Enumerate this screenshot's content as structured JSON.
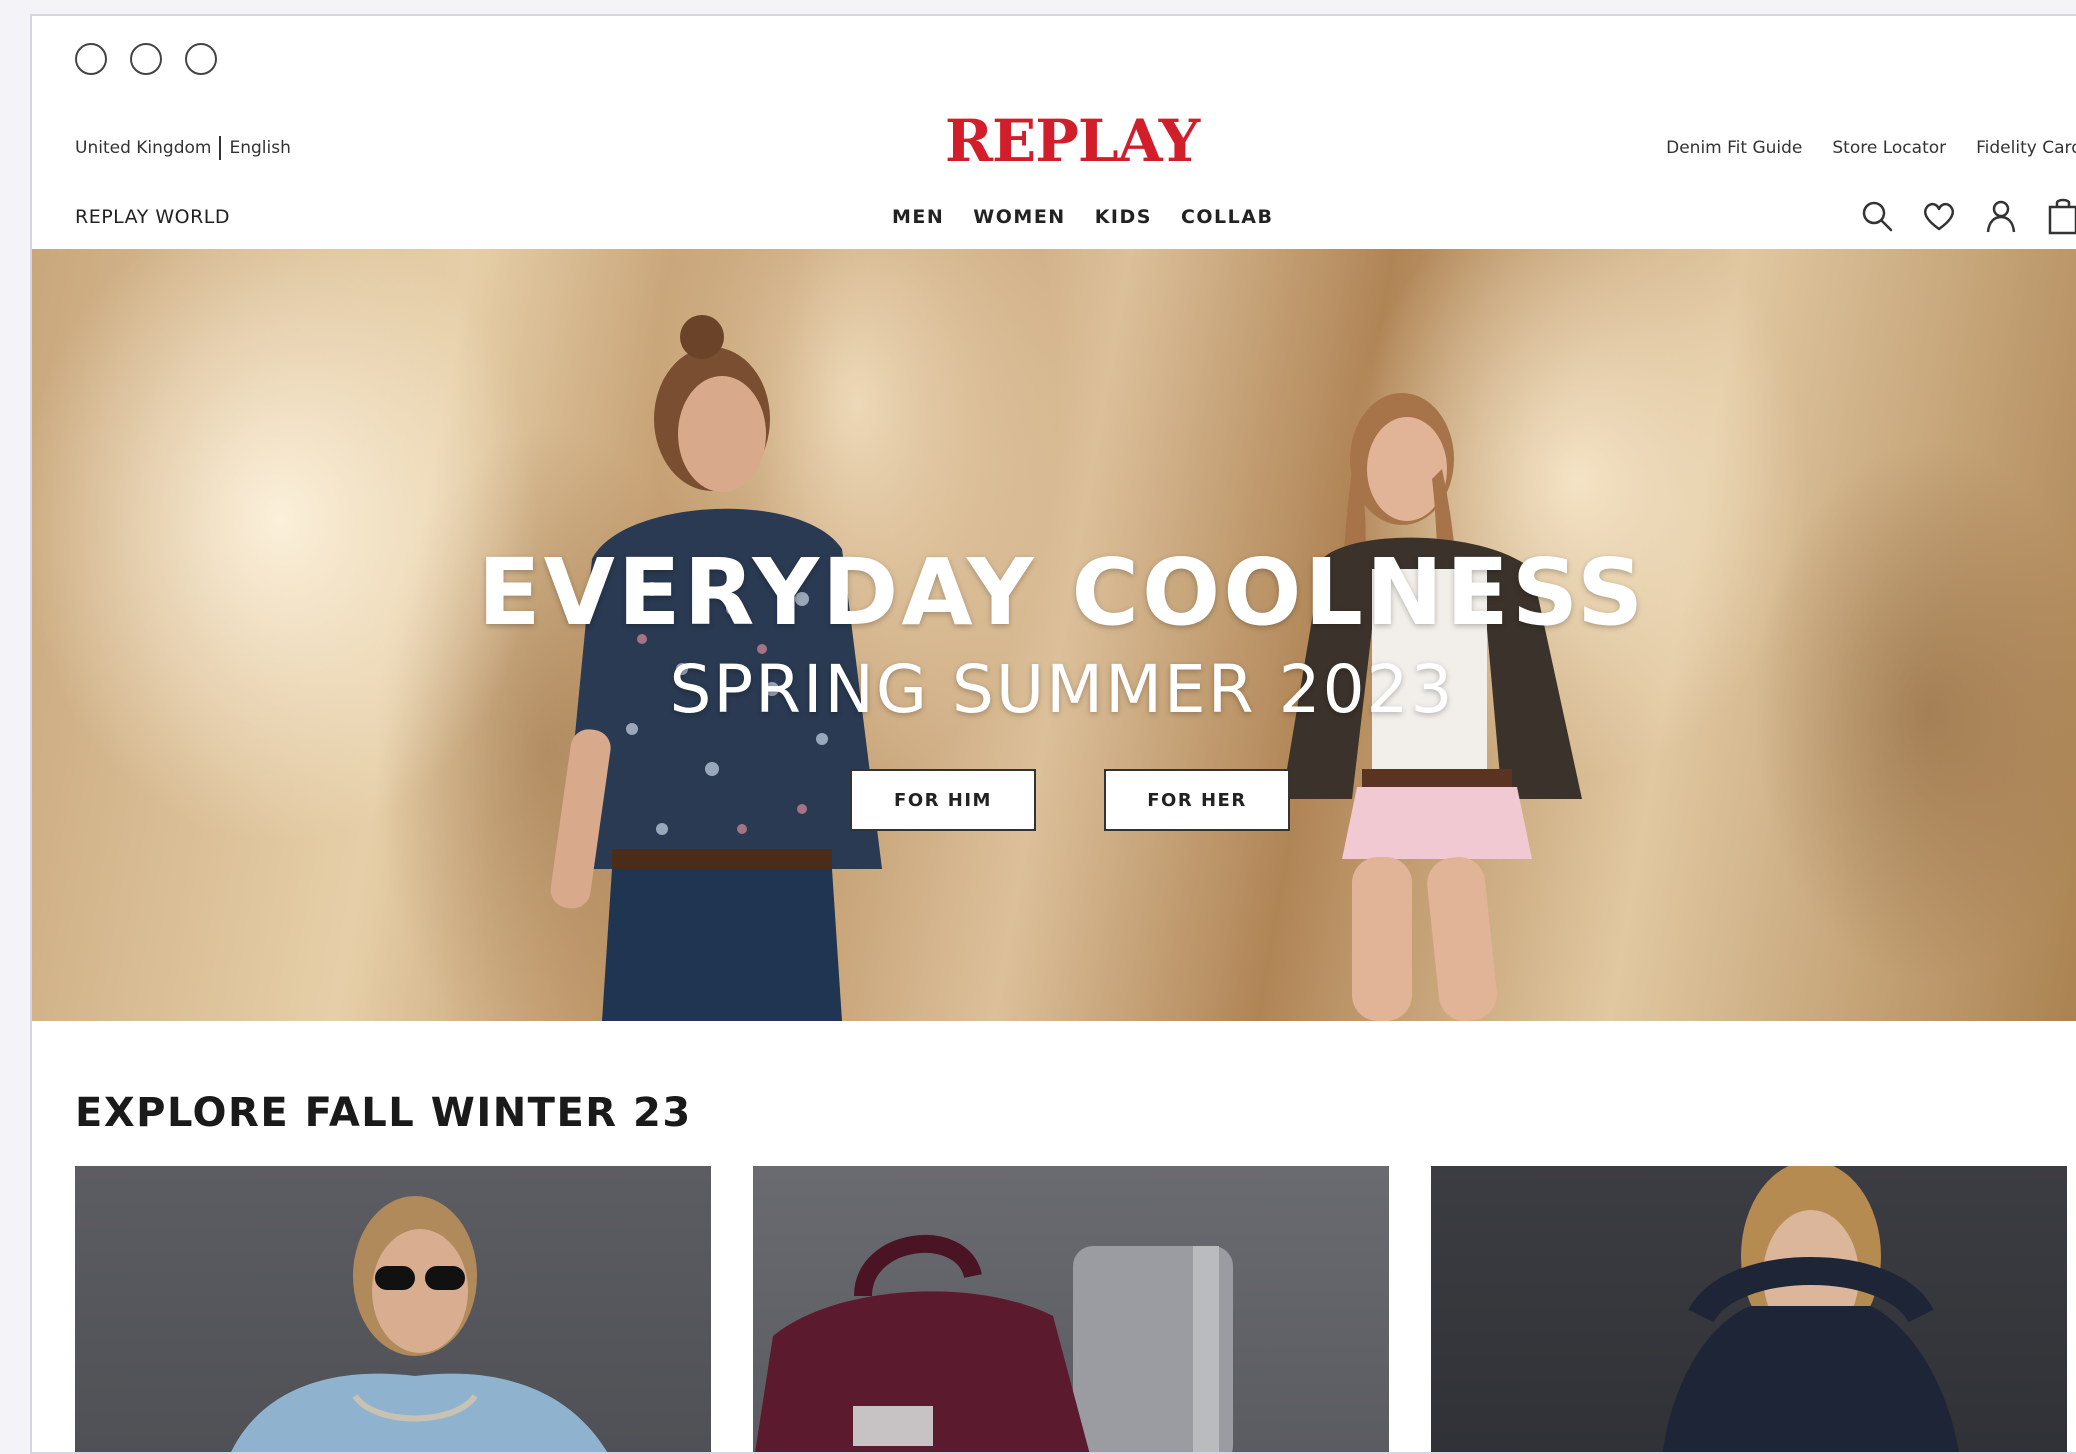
{
  "header": {
    "locale": {
      "country": "United Kingdom",
      "language": "English"
    },
    "brand": "REPLAY",
    "brand_color": "#d21e2b",
    "utility_links": [
      "Denim Fit Guide",
      "Store Locator",
      "Fidelity Card"
    ],
    "replay_world": "REPLAY WORLD",
    "nav": [
      "MEN",
      "WOMEN",
      "KIDS",
      "COLLAB"
    ],
    "icons": [
      "search-icon",
      "heart-icon",
      "user-icon",
      "bag-icon"
    ]
  },
  "hero": {
    "title": "EVERYDAY COOLNESS",
    "subtitle": "SPRING SUMMER 2023",
    "buttons": [
      "FOR HIM",
      "FOR HER"
    ]
  },
  "explore": {
    "title": "EXPLORE FALL WINTER 23"
  }
}
